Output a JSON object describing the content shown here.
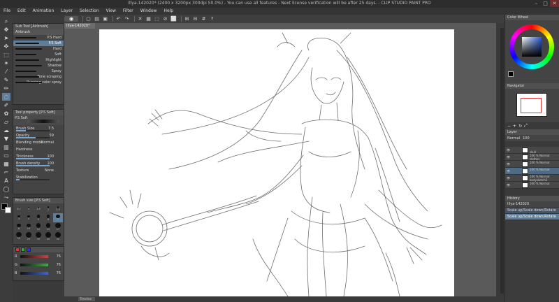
{
  "window": {
    "title": "Illya-142020* (2400 x 3200px 300dpi 50.0%)  - You can use all features - Next license verification will be after 25 days. - CLIP STUDIO PAINT PRO",
    "min_icon": "–",
    "max_icon": "□",
    "close_icon": "✕"
  },
  "menu": [
    "File",
    "Edit",
    "Animation",
    "Layer",
    "Selection",
    "View",
    "Filter",
    "Window",
    "Help"
  ],
  "doc_tab": "Illya-142020*",
  "sub_tool": {
    "header": "Sub Tool [Airbrush]",
    "group": "Airbrush",
    "items": [
      {
        "label": "P.S Hard",
        "selected": false
      },
      {
        "label": "P.S Soft",
        "selected": true
      },
      {
        "label": "Hard",
        "selected": false
      },
      {
        "label": "Soft",
        "selected": false
      },
      {
        "label": "Highlight",
        "selected": false
      },
      {
        "label": "Shadow",
        "selected": false
      },
      {
        "label": "Spray",
        "selected": false
      },
      {
        "label": "Tone scraping",
        "selected": false
      },
      {
        "label": "Running color spray",
        "selected": false
      }
    ]
  },
  "tool_property": {
    "header": "Tool property [P.S Soft]",
    "brush_name": "P.S Soft",
    "rows": [
      {
        "label": "Brush Size",
        "value": "7.5",
        "fill": 0.3
      },
      {
        "label": "Opacity",
        "value": "59",
        "fill": 0.59
      },
      {
        "label": "Blending mode",
        "value": "Normal",
        "fill": null
      },
      {
        "label": "Hardness",
        "value": "",
        "fill": null
      },
      {
        "label": "Thickness",
        "value": "100",
        "fill": 1.0
      },
      {
        "label": "Brush density",
        "value": "100",
        "fill": 1.0
      },
      {
        "label": "Texture",
        "value": "None",
        "fill": null
      },
      {
        "label": "Stabilization",
        "value": "",
        "fill": 0.1
      }
    ]
  },
  "brush_size": {
    "header": "Brush size [P.S Soft]",
    "sizes": [
      "0.7",
      "1",
      "1.5",
      "2",
      "2.5",
      "3",
      "4",
      "5",
      "6",
      "7",
      "8",
      "10",
      "12",
      "15",
      "17",
      "20",
      "25",
      "30",
      "40",
      "50"
    ]
  },
  "color_sliders": [
    {
      "name": "R",
      "value": "76",
      "color": "#c44"
    },
    {
      "name": "G",
      "value": "76",
      "color": "#4a4"
    },
    {
      "name": "B",
      "value": "76",
      "color": "#46c"
    }
  ],
  "color_wheel": {
    "header": "Color Wheel"
  },
  "navigator": {
    "header": "Navigator"
  },
  "layer_panel": {
    "header": "Layer",
    "blend": "Normal",
    "opacity": "100",
    "layers": [
      {
        "pct": "",
        "mode": "",
        "name": "skull",
        "selected": false
      },
      {
        "pct": "100 %",
        "mode": "Normal",
        "name": "clothes",
        "selected": false
      },
      {
        "pct": "100 %",
        "mode": "Normal",
        "name": "",
        "selected": false
      },
      {
        "pct": "100 %",
        "mode": "Normal",
        "name": "",
        "selected": true
      },
      {
        "pct": "100 %",
        "mode": "Normal",
        "name": "bodysketch2",
        "selected": false
      },
      {
        "pct": "100 %",
        "mode": "Normal",
        "name": "",
        "selected": false
      }
    ]
  },
  "history": {
    "header": "History",
    "doc": "Illya-142020",
    "items": [
      {
        "label": "Scale up/Scale down/Rotate",
        "selected": false
      },
      {
        "label": "Scale up/Scale down/Rotate",
        "selected": true
      }
    ]
  },
  "timeline_tab": "Timeline"
}
